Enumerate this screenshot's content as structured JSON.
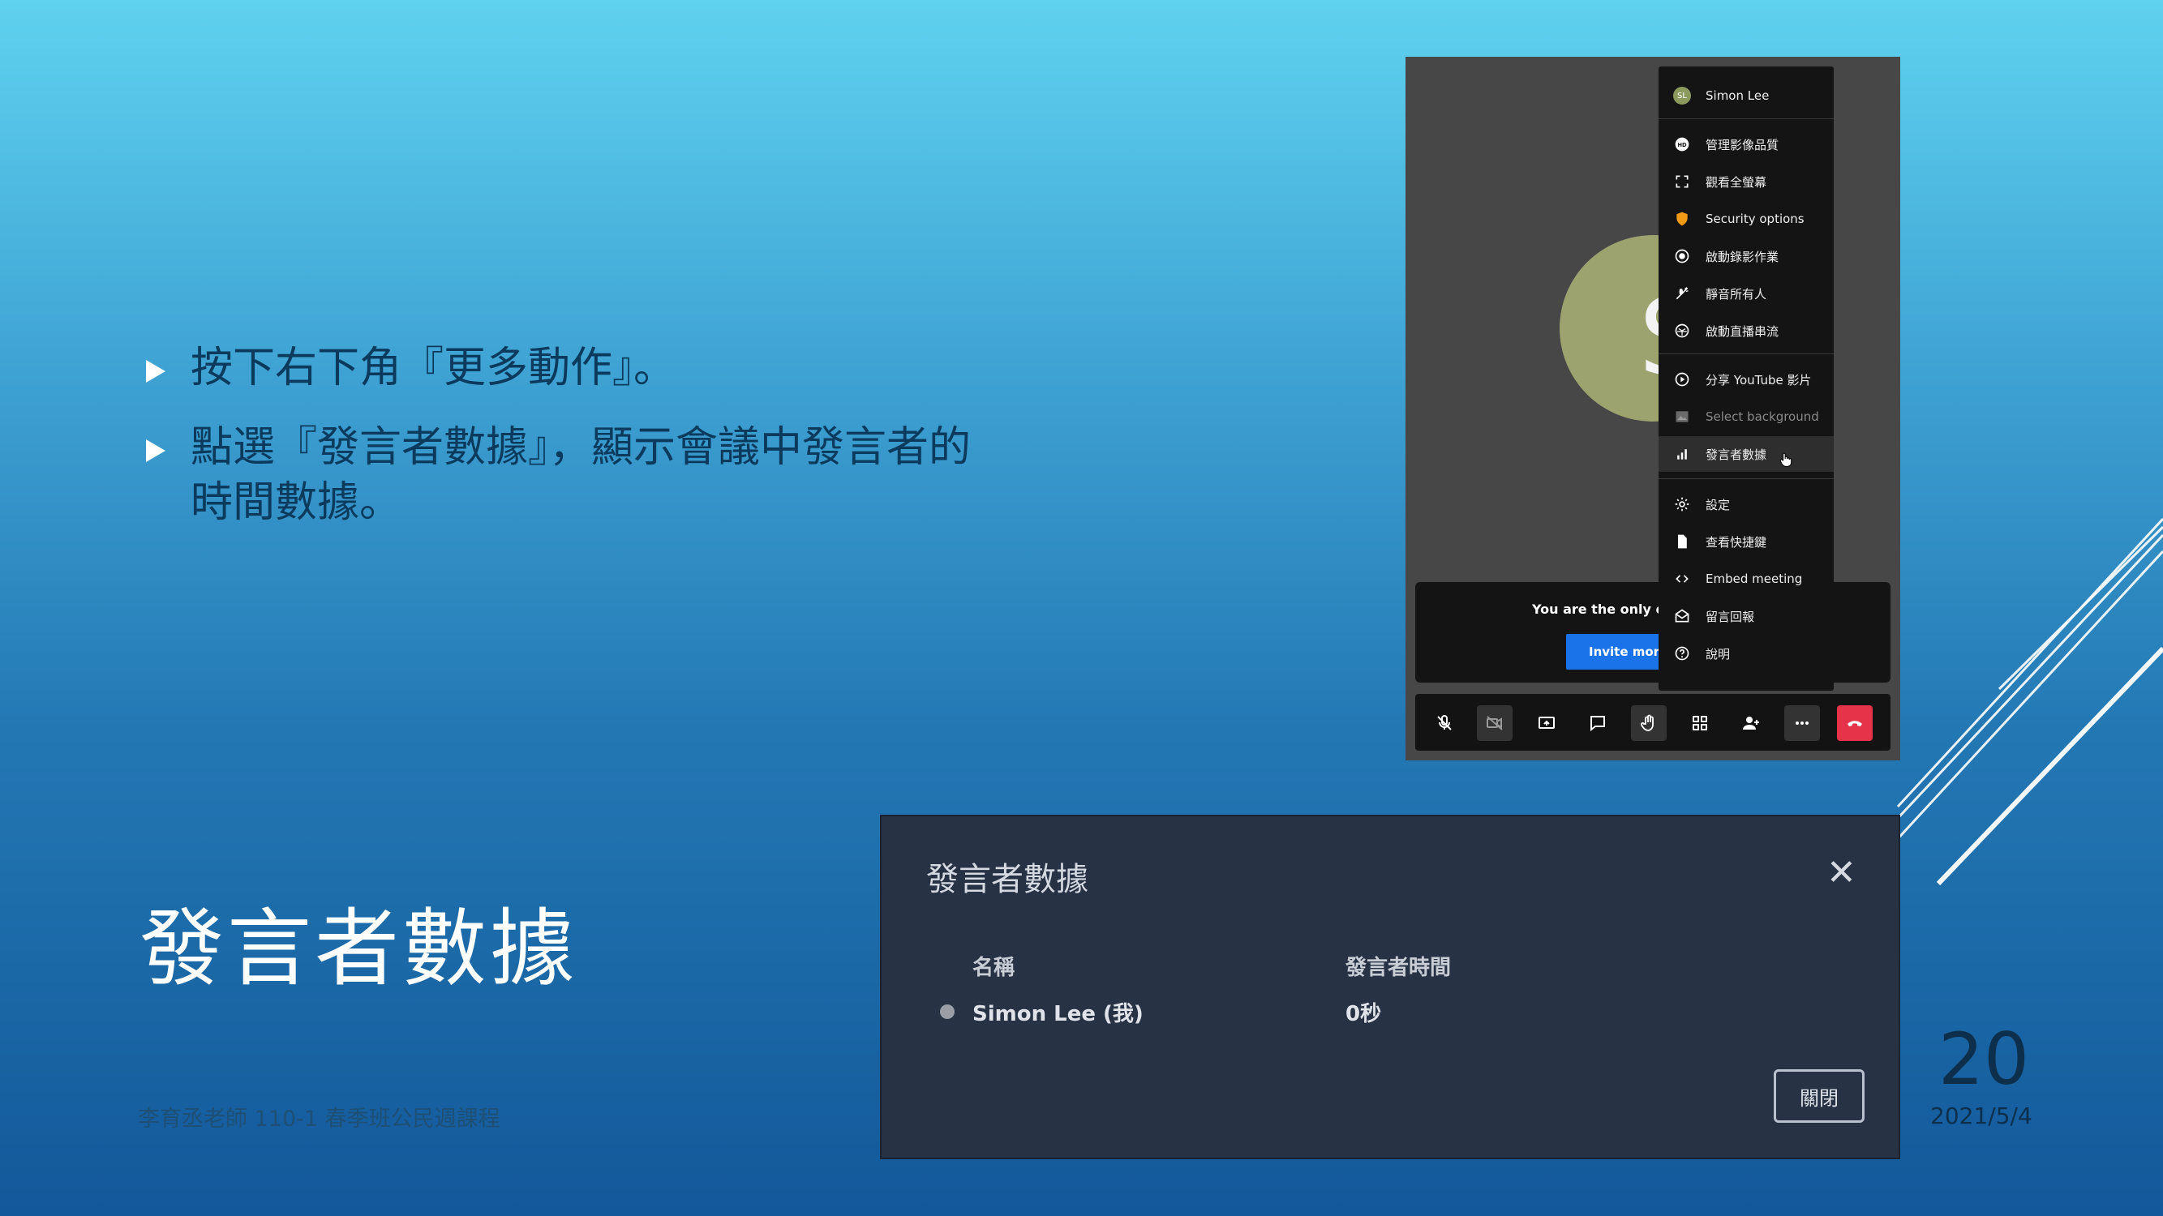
{
  "slide": {
    "bullets": [
      "按下右下角『更多動作』。",
      "點選『發言者數據』，顯示會議中發言者的時間數據。"
    ],
    "title": "發言者數據",
    "footer": "李育丞老師 110-1 春季班公民週課程",
    "page_number": "20",
    "date": "2021/5/4"
  },
  "meeting": {
    "avatar_letter": "S",
    "notice_text": "You are the only one in the meeting",
    "invite_label": "Invite more people",
    "menu": {
      "user_name": "Simon Lee",
      "user_initials": "SL",
      "items": [
        {
          "label": "管理影像品質",
          "icon": "hd-icon"
        },
        {
          "label": "觀看全螢幕",
          "icon": "fullscreen-icon"
        },
        {
          "label": "Security options",
          "icon": "shield-icon"
        },
        {
          "label": "啟動錄影作業",
          "icon": "record-icon"
        },
        {
          "label": "靜音所有人",
          "icon": "mute-all-icon"
        },
        {
          "label": "啟動直播串流",
          "icon": "live-stream-icon"
        },
        {
          "label": "分享 YouTube 影片",
          "icon": "youtube-play-icon"
        },
        {
          "label": "Select background",
          "icon": "background-icon"
        },
        {
          "label": "發言者數據",
          "icon": "bar-chart-icon"
        },
        {
          "label": "設定",
          "icon": "gear-icon"
        },
        {
          "label": "查看快捷鍵",
          "icon": "document-icon"
        },
        {
          "label": "Embed meeting",
          "icon": "code-icon"
        },
        {
          "label": "留言回報",
          "icon": "feedback-icon"
        },
        {
          "label": "說明",
          "icon": "help-icon"
        }
      ]
    },
    "toolbar_buttons": [
      "mic-off-icon",
      "camera-off-icon",
      "screen-share-icon",
      "chat-icon",
      "raise-hand-icon",
      "tile-view-icon",
      "invite-icon",
      "more-actions-icon",
      "hangup-icon"
    ],
    "colors": {
      "hangup": "#e6334a",
      "invite": "#1a73e8",
      "avatar": "#9ca36f",
      "security": "#f29b16"
    }
  },
  "stats_dialog": {
    "title": "發言者數據",
    "col_name": "名稱",
    "col_time": "發言者時間",
    "rows": [
      {
        "name": "Simon Lee (我)",
        "time": "0秒"
      }
    ],
    "close_button": "關閉"
  }
}
